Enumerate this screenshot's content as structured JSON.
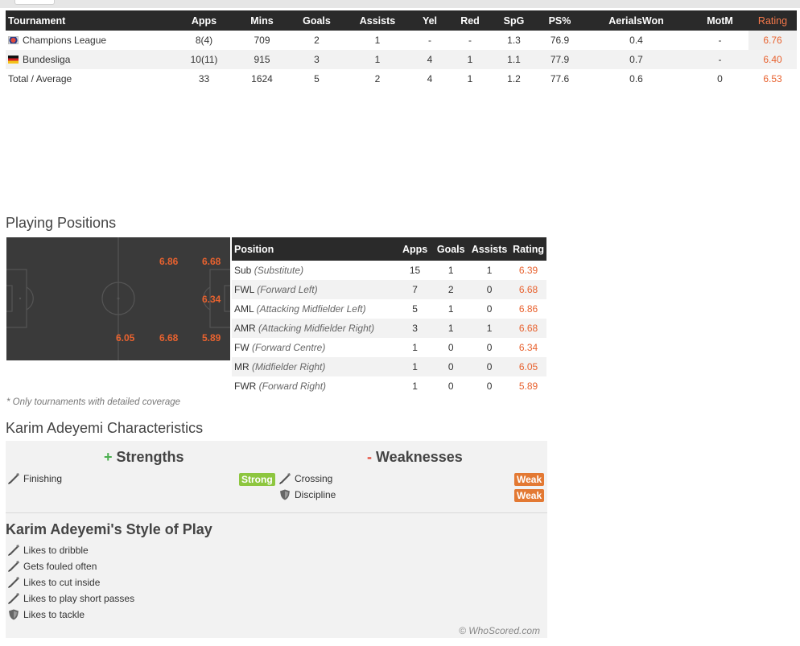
{
  "summary_table": {
    "headers": [
      "Tournament",
      "Apps",
      "Mins",
      "Goals",
      "Assists",
      "Yel",
      "Red",
      "SpG",
      "PS%",
      "AerialsWon",
      "MotM",
      "Rating"
    ],
    "rows": [
      {
        "tournament": "Champions League",
        "flag": "champions-league-icon",
        "apps": "8(4)",
        "mins": "709",
        "goals": "2",
        "assists": "1",
        "yel": "-",
        "red": "-",
        "spg": "1.3",
        "ps": "76.9",
        "aerials": "0.4",
        "motm": "-",
        "rating": "6.76"
      },
      {
        "tournament": "Bundesliga",
        "flag": "germany-flag-icon",
        "apps": "10(11)",
        "mins": "915",
        "goals": "3",
        "assists": "1",
        "yel": "4",
        "red": "1",
        "spg": "1.1",
        "ps": "77.9",
        "aerials": "0.7",
        "motm": "-",
        "rating": "6.40"
      }
    ],
    "total": {
      "label": "Total / Average",
      "apps": "33",
      "mins": "1624",
      "goals": "5",
      "assists": "2",
      "yel": "4",
      "red": "1",
      "spg": "1.2",
      "ps": "77.6",
      "aerials": "0.6",
      "motm": "0",
      "rating": "6.53"
    }
  },
  "positions_section": {
    "title": "Playing Positions",
    "pitch_ratings": {
      "aml": "6.86",
      "fwl": "6.68",
      "fw": "6.34",
      "mr": "6.05",
      "amr": "6.68",
      "fwr": "5.89"
    },
    "headers": [
      "Position",
      "Apps",
      "Goals",
      "Assists",
      "Rating"
    ],
    "rows": [
      {
        "code": "Sub",
        "desc": "(Substitute)",
        "apps": "15",
        "goals": "1",
        "assists": "1",
        "rating": "6.39"
      },
      {
        "code": "FWL",
        "desc": "(Forward Left)",
        "apps": "7",
        "goals": "2",
        "assists": "0",
        "rating": "6.68"
      },
      {
        "code": "AML",
        "desc": "(Attacking Midfielder Left)",
        "apps": "5",
        "goals": "1",
        "assists": "0",
        "rating": "6.86"
      },
      {
        "code": "AMR",
        "desc": "(Attacking Midfielder Right)",
        "apps": "3",
        "goals": "1",
        "assists": "1",
        "rating": "6.68"
      },
      {
        "code": "FW",
        "desc": "(Forward Centre)",
        "apps": "1",
        "goals": "0",
        "assists": "0",
        "rating": "6.34"
      },
      {
        "code": "MR",
        "desc": "(Midfielder Right)",
        "apps": "1",
        "goals": "0",
        "assists": "0",
        "rating": "6.05"
      },
      {
        "code": "FWR",
        "desc": "(Forward Right)",
        "apps": "1",
        "goals": "0",
        "assists": "0",
        "rating": "5.89"
      }
    ],
    "footnote": "* Only tournaments with detailed coverage"
  },
  "characteristics": {
    "title": "Karim Adeyemi Characteristics",
    "strengths_sign": "+",
    "strengths_label": "Strengths",
    "weaknesses_sign": "-",
    "weaknesses_label": "Weaknesses",
    "strengths": [
      {
        "label": "Finishing",
        "level": "Strong",
        "icon": "boot-icon"
      }
    ],
    "weaknesses": [
      {
        "label": "Crossing",
        "level": "Weak",
        "icon": "boot-icon"
      },
      {
        "label": "Discipline",
        "level": "Weak",
        "icon": "shield-icon"
      }
    ],
    "style_title": "Karim Adeyemi's Style of Play",
    "style_items": [
      {
        "label": "Likes to dribble",
        "icon": "boot-icon"
      },
      {
        "label": "Gets fouled often",
        "icon": "boot-icon"
      },
      {
        "label": "Likes to cut inside",
        "icon": "boot-icon"
      },
      {
        "label": "Likes to play short passes",
        "icon": "boot-icon"
      },
      {
        "label": "Likes to tackle",
        "icon": "shield-icon"
      }
    ],
    "copyright": "© WhoScored.com"
  },
  "colors": {
    "rating": "#e8622f",
    "header_bg": "#2a2a2a",
    "strong": "#8dc63f",
    "weak": "#e37933"
  }
}
